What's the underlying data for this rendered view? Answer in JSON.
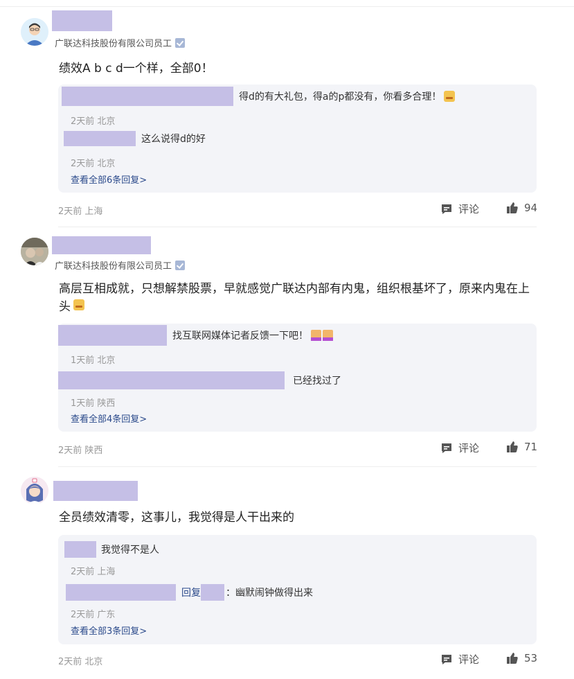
{
  "comments": [
    {
      "org": "广联达科技股份有限公司员工",
      "text": "绩效A b c d一个样，全部0！",
      "replies": [
        {
          "text": "得d的有大礼包，得a的p都没有，你看多合理！",
          "meta": "2天前 北京"
        },
        {
          "text": "这么说得d的好",
          "meta": "2天前 北京"
        }
      ],
      "more": "查看全部6条回复>",
      "time": "2天前 上海",
      "comment_label": "评论",
      "likes": "94"
    },
    {
      "org": "广联达科技股份有限公司员工",
      "text": "高层互相成就，只想解禁股票，早就感觉广联达内部有内鬼，组织根基坏了，原来内鬼在上头",
      "replies": [
        {
          "text": "找互联网媒体记者反馈一下吧！",
          "meta": "1天前 北京"
        },
        {
          "text": "已经找过了",
          "meta": "1天前 陕西"
        }
      ],
      "more": "查看全部4条回复>",
      "time": "2天前 陕西",
      "comment_label": "评论",
      "likes": "71"
    },
    {
      "org": "",
      "text": "全员绩效清零，这事儿，我觉得是人干出来的",
      "replies": [
        {
          "text": "我觉得不是人",
          "meta": "2天前 上海"
        },
        {
          "reply_prefix": "回复",
          "text": "：幽默闹钟做得出来",
          "meta": "2天前 广东"
        }
      ],
      "more": "查看全部3条回复>",
      "time": "2天前 北京",
      "comment_label": "评论",
      "likes": "53"
    }
  ],
  "colors": {
    "redacted": "#c5bfe6",
    "reply_bg": "#f3f4f8",
    "link": "#2b4a8b"
  },
  "icons": [
    "user-avatar-icon",
    "verified-icon",
    "comment-icon",
    "thumbs-up-icon"
  ]
}
